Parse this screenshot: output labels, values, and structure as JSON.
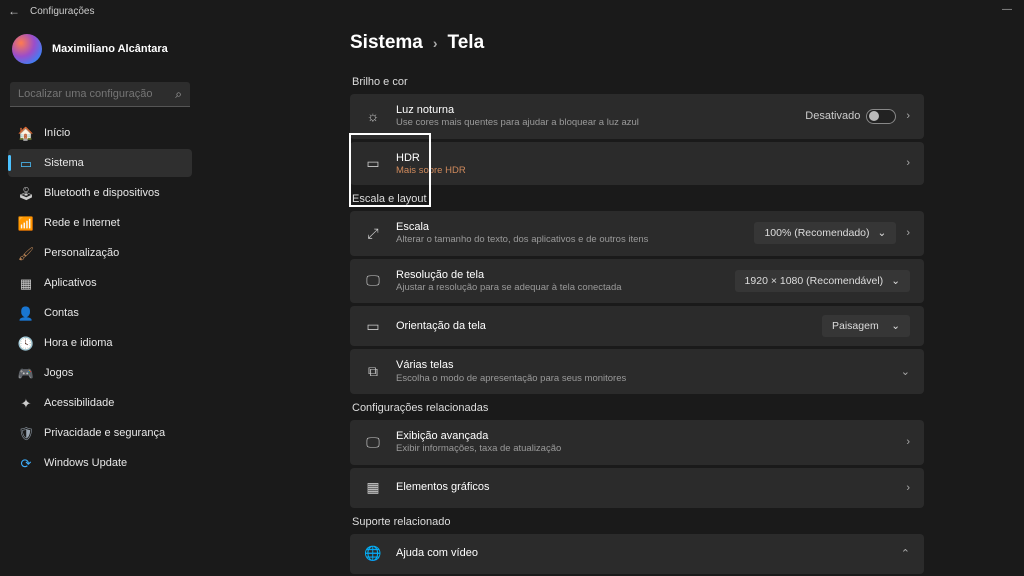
{
  "titlebar": {
    "title": "Configurações"
  },
  "profile": {
    "name": "Maximiliano Alcântara"
  },
  "search": {
    "placeholder": "Localizar uma configuração"
  },
  "sidebar": {
    "items": [
      {
        "label": "Início",
        "icon": "🏠",
        "color": "#f7a05a"
      },
      {
        "label": "Sistema",
        "icon": "▭",
        "color": "#4cc2ff",
        "active": true
      },
      {
        "label": "Bluetooth e dispositivos",
        "icon": "🕹",
        "color": "#ccc"
      },
      {
        "label": "Rede e Internet",
        "icon": "📶",
        "color": "#3fb0ff"
      },
      {
        "label": "Personalização",
        "icon": "🖌",
        "color": "#b98455"
      },
      {
        "label": "Aplicativos",
        "icon": "▦",
        "color": "#ccc"
      },
      {
        "label": "Contas",
        "icon": "👤",
        "color": "#7aa6d8"
      },
      {
        "label": "Hora e idioma",
        "icon": "🕓",
        "color": "#e0c97a"
      },
      {
        "label": "Jogos",
        "icon": "🎮",
        "color": "#8fa3c6"
      },
      {
        "label": "Acessibilidade",
        "icon": "✦",
        "color": "#ccc"
      },
      {
        "label": "Privacidade e segurança",
        "icon": "🛡",
        "color": "#9aa6b2"
      },
      {
        "label": "Windows Update",
        "icon": "⟳",
        "color": "#3fb0ff"
      }
    ]
  },
  "breadcrumb": {
    "parent": "Sistema",
    "sep": "›",
    "current": "Tela"
  },
  "sections": {
    "brightness": {
      "label": "Brilho e cor",
      "items": {
        "nightlight": {
          "title": "Luz noturna",
          "sub": "Use cores mais quentes para ajudar a bloquear a luz azul",
          "status": "Desativado"
        },
        "hdr": {
          "title": "HDR",
          "link": "Mais sobre HDR"
        }
      }
    },
    "scale": {
      "label": "Escala e layout",
      "items": {
        "scale": {
          "title": "Escala",
          "sub": "Alterar o tamanho do texto, dos aplicativos e de outros itens",
          "value": "100% (Recomendado)"
        },
        "resolution": {
          "title": "Resolução de tela",
          "sub": "Ajustar a resolução para se adequar à tela conectada",
          "value": "1920 × 1080 (Recomendável)"
        },
        "orientation": {
          "title": "Orientação da tela",
          "value": "Paisagem"
        },
        "multiple": {
          "title": "Várias telas",
          "sub": "Escolha o modo de apresentação para seus monitores"
        }
      }
    },
    "related": {
      "label": "Configurações relacionadas",
      "items": {
        "advanced": {
          "title": "Exibição avançada",
          "sub": "Exibir informações, taxa de atualização"
        },
        "graphics": {
          "title": "Elementos gráficos"
        }
      }
    },
    "support": {
      "label": "Suporte relacionado",
      "items": {
        "help": {
          "title": "Ajuda com vídeo"
        }
      }
    }
  }
}
